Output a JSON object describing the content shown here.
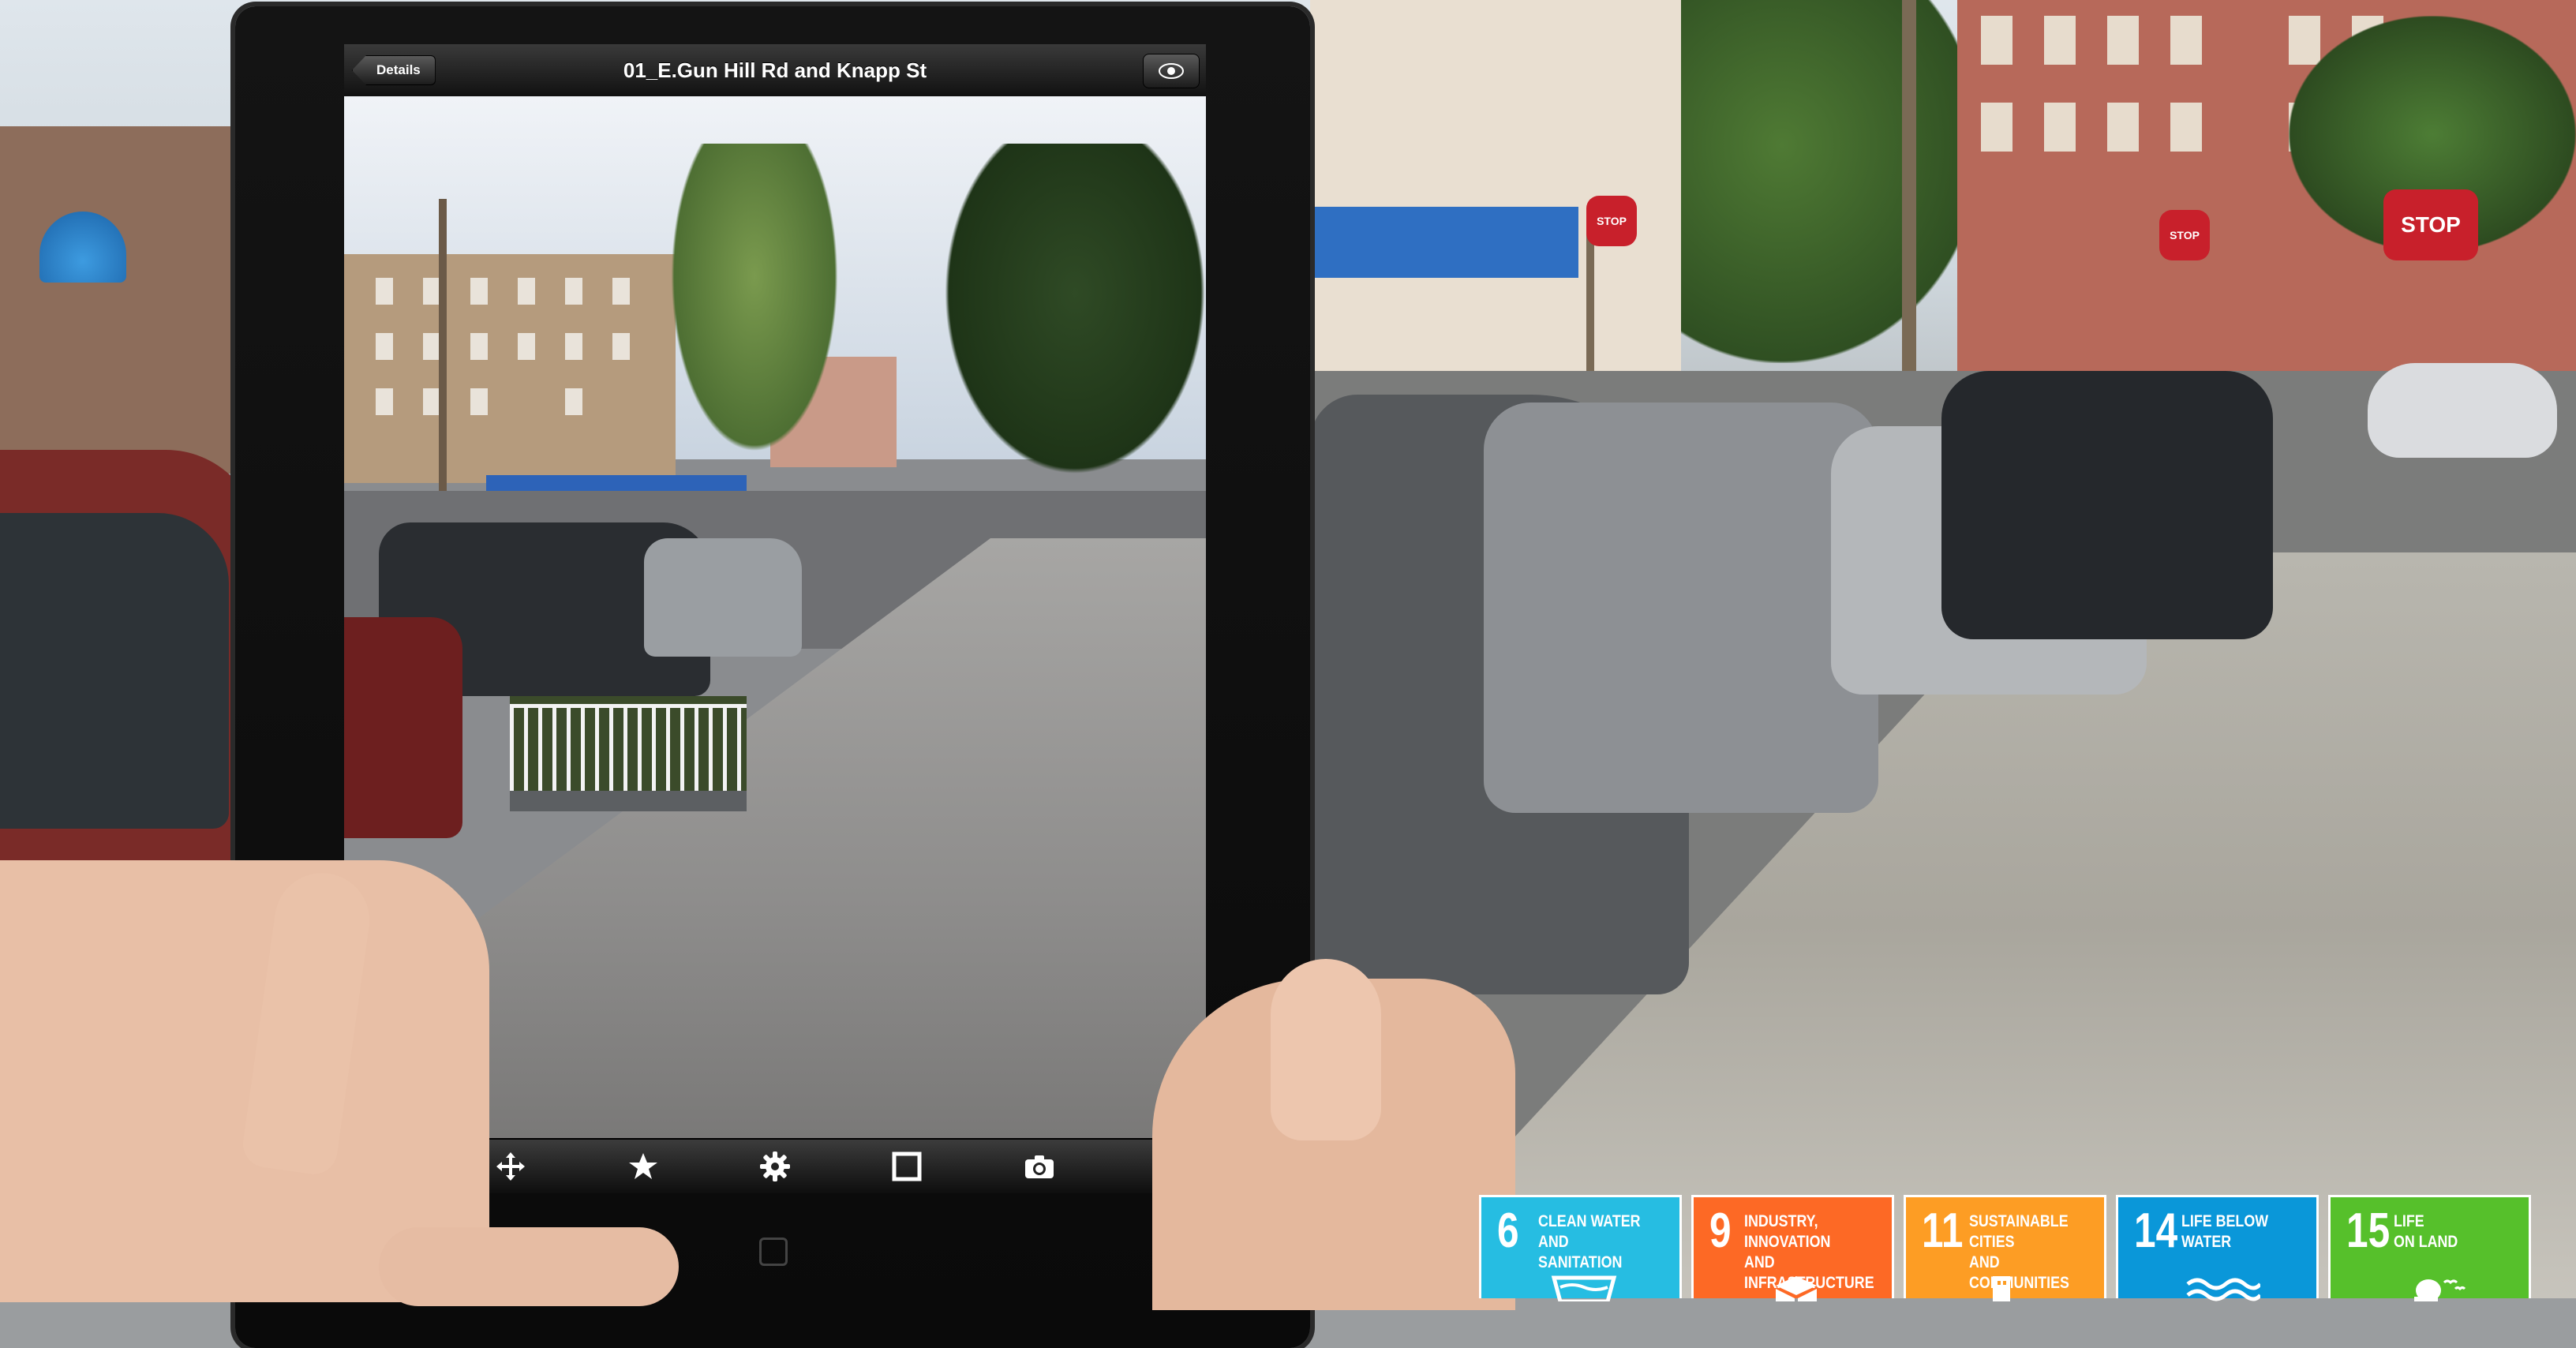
{
  "nav": {
    "details_label": "Details",
    "title": "01_E.Gun Hill Rd and Knapp St"
  },
  "toolbar": {
    "buttons": [
      "target-icon",
      "move-icon",
      "star-icon",
      "gear-icon",
      "square-icon",
      "camera-icon",
      "info-icon"
    ]
  },
  "signs": {
    "stop": "STOP"
  },
  "sdg": [
    {
      "num": "6",
      "label": "CLEAN WATER\nAND SANITATION",
      "color": "#26bde2"
    },
    {
      "num": "9",
      "label": "INDUSTRY, INNOVATION\nAND INFRASTRUCTURE",
      "color": "#fd6925"
    },
    {
      "num": "11",
      "label": "SUSTAINABLE CITIES\nAND COMMUNITIES",
      "color": "#fd9d24"
    },
    {
      "num": "14",
      "label": "LIFE BELOW\nWATER",
      "color": "#0a97d9"
    },
    {
      "num": "15",
      "label": "LIFE\nON LAND",
      "color": "#56c02b"
    }
  ]
}
